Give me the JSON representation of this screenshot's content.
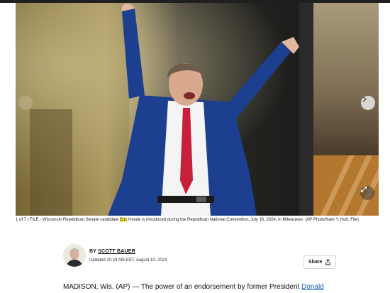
{
  "gallery": {
    "counter": "1 of 7",
    "caption_prefix": "FILE - Wisconsin Republican Senate candidate ",
    "caption_highlight": "Eric",
    "caption_suffix": " Hovde is introduced during the Republican National Convention, July 16, 2024, in Milwaukee. (AP Photo/Nam Y. Huh, File)",
    "next_icon": "chevron-right-icon",
    "expand_icon": "expand-icon"
  },
  "byline": {
    "by": "BY",
    "author": "SCOTT BAUER",
    "updated": "Updated 10:24 AM EDT, August 10, 2024"
  },
  "share": {
    "label": "Share"
  },
  "article": {
    "lead_text": "MADISON, Wis. (AP) — The power of an endorsement by former President ",
    "lead_link": "Donald"
  },
  "colors": {
    "accent_link": "#1a5fb4",
    "highlight": "#f7e93a",
    "suit": "#1c3f8f",
    "tie": "#c8203a"
  }
}
